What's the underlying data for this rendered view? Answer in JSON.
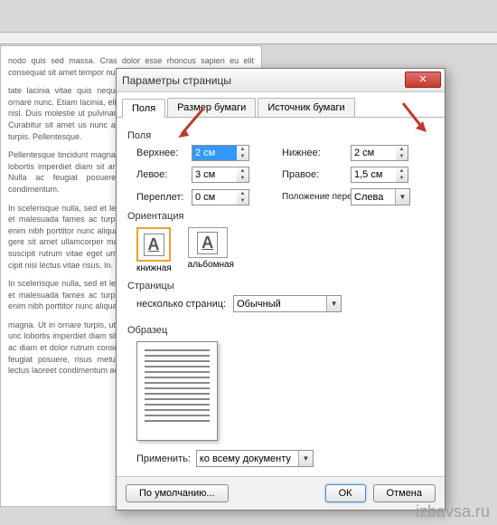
{
  "dialog": {
    "title": "Параметры страницы",
    "tabs": [
      "Поля",
      "Размер бумаги",
      "Источник бумаги"
    ],
    "active_tab": 0,
    "groups": {
      "fields_label": "Поля",
      "orientation_label": "Ориентация",
      "pages_label": "Страницы",
      "preview_label": "Образец"
    },
    "margins": {
      "top_label": "Верхнее:",
      "top_value": "2 см",
      "bottom_label": "Нижнее:",
      "bottom_value": "2 см",
      "left_label": "Левое:",
      "left_value": "3 см",
      "right_label": "Правое:",
      "right_value": "1,5 см",
      "gutter_label": "Переплет:",
      "gutter_value": "0 см",
      "gutter_pos_label": "Положение переплета:",
      "gutter_pos_value": "Слева"
    },
    "orientation": {
      "portrait": "книжная",
      "landscape": "альбомная",
      "selected": "portrait"
    },
    "pages": {
      "multi_label": "несколько страниц:",
      "multi_value": "Обычный"
    },
    "apply": {
      "label": "Применить:",
      "value": "ко всему документу"
    },
    "buttons": {
      "default": "По умолчанию...",
      "ok": "ОК",
      "cancel": "Отмена"
    }
  },
  "watermark": "izbavsa.ru",
  "doc_text": {
    "p1": "nodo quis sed massa. Cras dolor esse rhoncus sapien eu elit consequat sit amet tempor nunc, sodales.",
    "p2": "tate lacinia vitae quis neque. Nulla ornare posuere. Nulla quis ornare nunc. Etiam lacinia, elit nec nisi eget turpis. Quisque tempus nisl. Duis molestie ut pulvinar, vel massa viverra nulla onibus arcu. Curabitur sit amet us nunc accumsan. Aliquam id onec quis ligula turpis. Pellentesque.",
    "p3": "Pellentesque tincidunt magna. Ut in ornare turpis, ut consequat unc lobortis imperdiet diam sit amet. Duis ac diam et dolor rutrum et. Nulla ac feugiat posuere, risus accumsan lectus laoreet condimentum.",
    "p4": "In scelerisque nulla, sed et leo. Curabitur suscipit pharetra et netus et malesuada fames ac turpis mi ac fermentum venenatis. Morbi enim nibh porttitor nunc aliquam purus eros et nisi tristique tristique gere sit amet ullamcorper magna. Pellentesque ullamcorper. Nulla suscipit rutrum vitae eget urna. Duis nisi, vel vulputate dolor. Sed cipit nisi lectus vitae risus. In.",
    "p5": "In scelerisque nulla, sed et leo. Curabitur suscipit pharetra et netus et malesuada fames ac turpis mi ac fermentum venenatis. Morbi enim nibh porttitor nunc aliquam purus eros et nisi tristique tristique.",
    "p6": "magna. Ut in ornare turpis, ut consequat sem. Phasellus vitae nulla unc lobortis imperdiet diam sit amet venenatis. Mauris a orci et duis ac diam et dolor rutrum consequat. Maecenas id convallis, nulla ac feugiat posuere, risus metus congue ligula, tristique accumsan lectus laoreet condimentum ac egestas sapien."
  }
}
